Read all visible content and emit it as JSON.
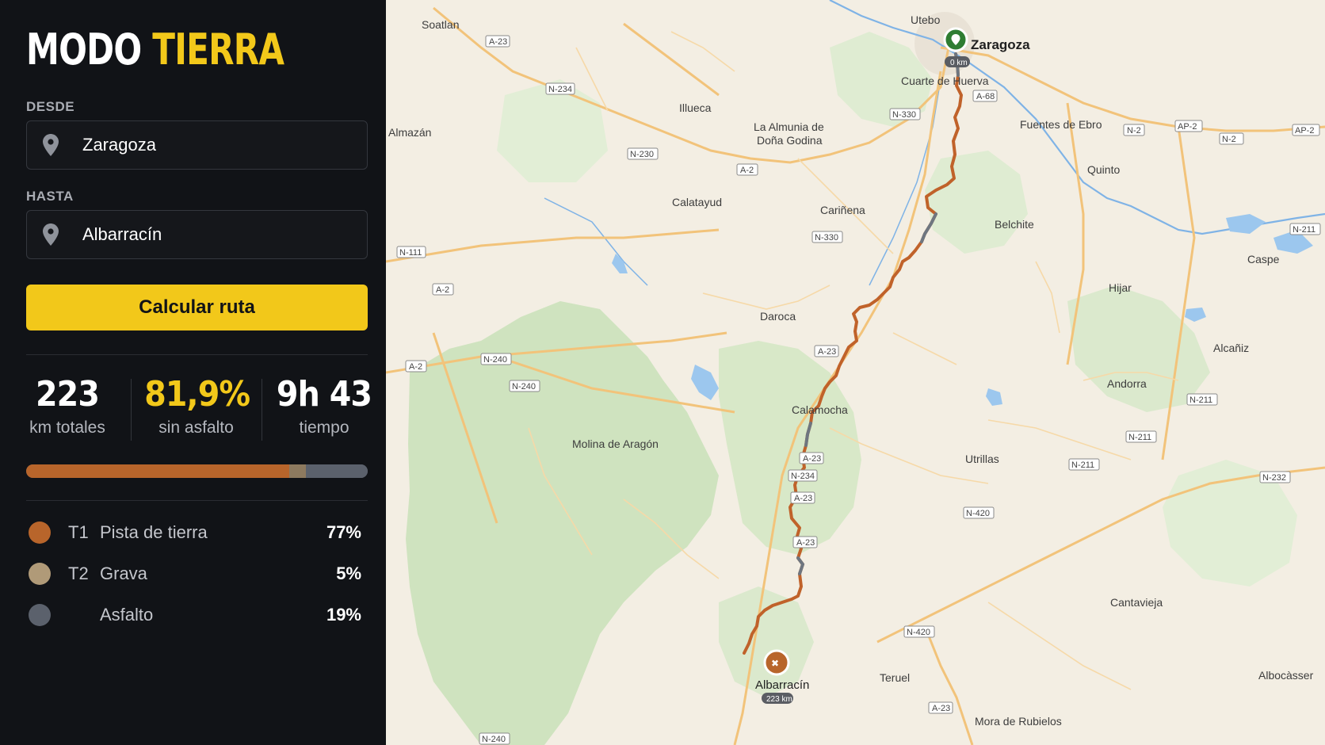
{
  "brand": {
    "word1": "MODO",
    "word2": "TIERRA",
    "color1": "#ffffff",
    "color2": "#f2c81a"
  },
  "from": {
    "label": "DESDE",
    "value": "Zaragoza",
    "icon": "map-pin-icon"
  },
  "to": {
    "label": "HASTA",
    "value": "Albarracín",
    "icon": "map-pin-icon"
  },
  "calculate_label": "Calcular ruta",
  "stats": {
    "distance": {
      "value": "223",
      "label": "km totales"
    },
    "unpaved": {
      "value": "81,9%",
      "label": "sin asfalto",
      "color": "#f2c81a"
    },
    "time": {
      "value": "9h 43",
      "label": "tiempo"
    }
  },
  "surface_bar": [
    {
      "name": "T1",
      "fraction": 0.77,
      "color": "#b8652b"
    },
    {
      "name": "T2",
      "fraction": 0.05,
      "color": "#8d7a5f"
    },
    {
      "name": "Asfalto",
      "fraction": 0.18,
      "color": "#5b616c"
    }
  ],
  "legend": [
    {
      "code": "T1",
      "name": "Pista de tierra",
      "pct": "77%",
      "color": "#b8652b"
    },
    {
      "code": "T2",
      "name": "Grava",
      "pct": "5%",
      "color": "#b09a78"
    },
    {
      "code": "",
      "name": "Asfalto",
      "pct": "19%",
      "color": "#5b616c"
    }
  ],
  "map": {
    "start": {
      "name": "Zaragoza",
      "km": "0 km",
      "color": "#2e7d32"
    },
    "end": {
      "name": "Albarracín",
      "km": "223 km",
      "color": "#b8652b"
    },
    "route_colors": {
      "dirt": "#c0622a",
      "asphalt": "#6e7680"
    },
    "places": [
      "Utebo",
      "Cuarte de Huerva",
      "Illueca",
      "La Almunia de",
      "Doña Godina",
      "Fuentes de Ebro",
      "Quinto",
      "Almazán",
      "Calatayud",
      "Cariñena",
      "Belchite",
      "Caspe",
      "Hijar",
      "Daroca",
      "Alcañiz",
      "Andorra",
      "Calamocha",
      "Molina de Aragón",
      "Utrillas",
      "Cantavieja",
      "Teruel",
      "Albocàsser",
      "Mora de Rubielos",
      "Soatlan"
    ],
    "roads": [
      "A-23",
      "N-234",
      "N-230",
      "A-2",
      "N-330",
      "A-68",
      "N-2",
      "AP-2",
      "N-111",
      "N-240",
      "N-211",
      "N-420",
      "N-232",
      "N-211",
      "A-23",
      "N-234",
      "N-330"
    ]
  }
}
